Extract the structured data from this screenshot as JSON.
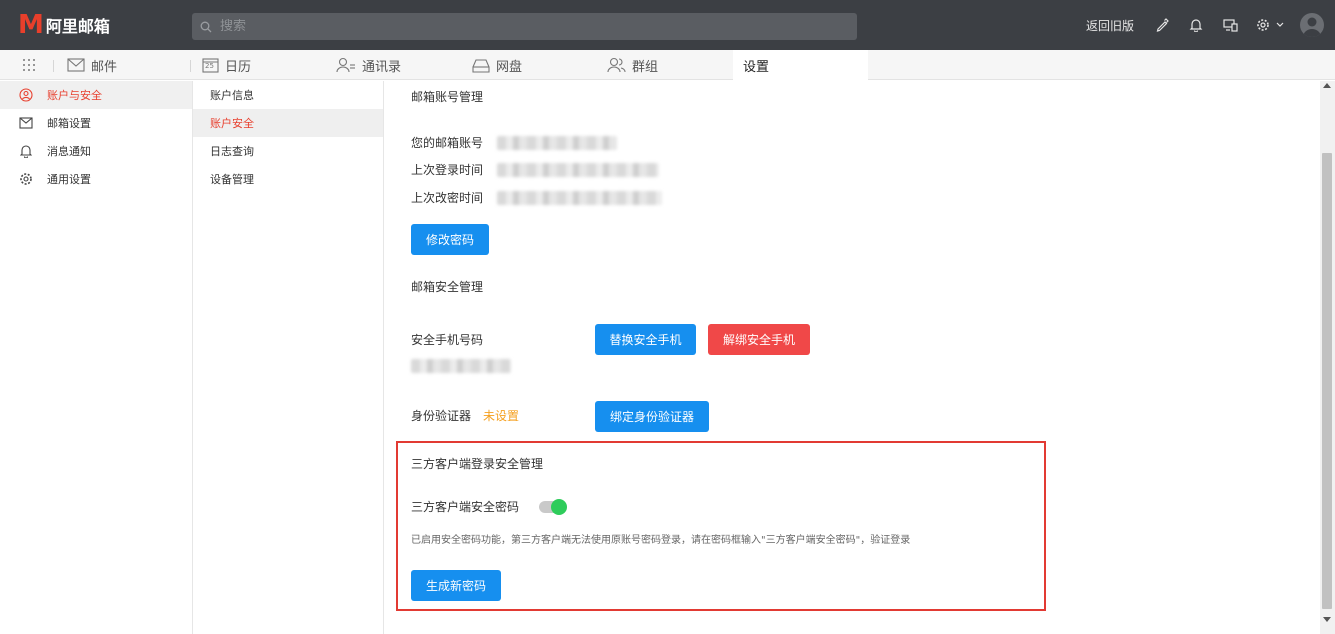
{
  "header": {
    "logo_text": "阿里邮箱",
    "search_placeholder": "搜索",
    "old_version_link": "返回旧版"
  },
  "nav_tabs": [
    {
      "label": "邮件",
      "icon": "mail-icon"
    },
    {
      "label": "日历",
      "icon": "calendar-icon",
      "day": "25"
    },
    {
      "label": "通讯录",
      "icon": "contacts-icon"
    },
    {
      "label": "网盘",
      "icon": "cloud-drive-icon"
    },
    {
      "label": "群组",
      "icon": "group-icon"
    },
    {
      "label": "设置",
      "active": true
    }
  ],
  "left_menu": [
    {
      "label": "账户与安全",
      "icon": "account-icon",
      "active": true
    },
    {
      "label": "邮箱设置",
      "icon": "mail-settings-icon"
    },
    {
      "label": "消息通知",
      "icon": "bell-icon"
    },
    {
      "label": "通用设置",
      "icon": "gear-icon"
    }
  ],
  "sub_menu": [
    {
      "label": "账户信息"
    },
    {
      "label": "账户安全",
      "active": true
    },
    {
      "label": "日志查询"
    },
    {
      "label": "设备管理"
    }
  ],
  "account": {
    "section_title": "邮箱账号管理",
    "email_label": "您的邮箱账号",
    "last_login_label": "上次登录时间",
    "last_pwd_change_label": "上次改密时间",
    "change_password_button": "修改密码"
  },
  "security": {
    "section_title": "邮箱安全管理",
    "phone_label": "安全手机号码",
    "replace_phone_button": "替换安全手机",
    "unbind_phone_button": "解绑安全手机",
    "authenticator_label": "身份验证器",
    "authenticator_status": "未设置",
    "bind_authenticator_button": "绑定身份验证器"
  },
  "third_party": {
    "section_title": "三方客户端登录安全管理",
    "password_label": "三方客户端安全密码",
    "toggle_on": true,
    "note": "已启用安全密码功能，第三方客户端无法使用原账号密码登录，请在密码框输入\"三方客户端安全密码\"，验证登录",
    "generate_button": "生成新密码"
  },
  "colors": {
    "accent_red": "#e8402f",
    "button_blue": "#168fef",
    "button_red": "#f04848",
    "warning_orange": "#f5a020",
    "toggle_green": "#2ecc5b",
    "topbar_bg": "#3c3f44"
  }
}
